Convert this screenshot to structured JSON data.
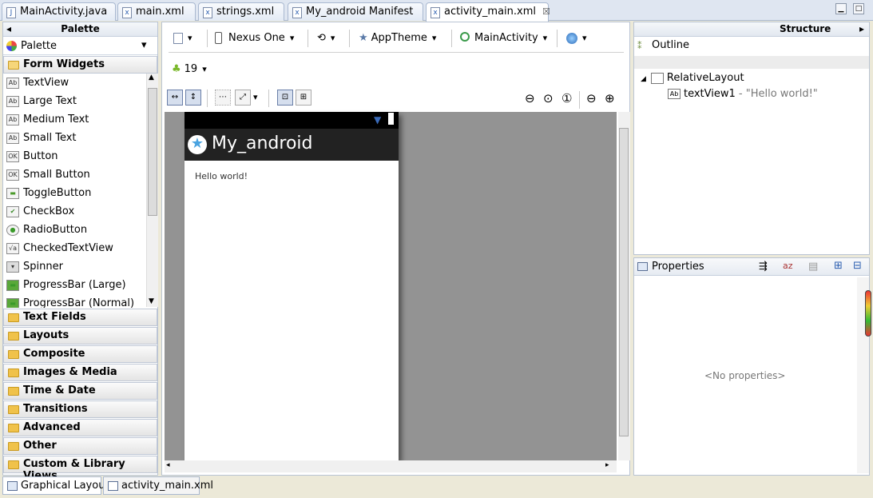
{
  "editor_tabs": [
    {
      "label": "MainActivity.java",
      "icon": "java-file-icon"
    },
    {
      "label": "main.xml",
      "icon": "xml-file-icon"
    },
    {
      "label": "strings.xml",
      "icon": "xml-file-icon"
    },
    {
      "label": "My_android Manifest",
      "icon": "manifest-file-icon"
    },
    {
      "label": "activity_main.xml",
      "icon": "xml-file-icon",
      "close": "☒"
    }
  ],
  "palette": {
    "title": "Palette",
    "selector": "Palette",
    "open_category": "Form Widgets",
    "widgets": [
      {
        "label": "TextView",
        "icon": "Ab"
      },
      {
        "label": "Large Text",
        "icon": "Ab"
      },
      {
        "label": "Medium Text",
        "icon": "Ab"
      },
      {
        "label": "Small Text",
        "icon": "Ab"
      },
      {
        "label": "Button",
        "icon": "OK"
      },
      {
        "label": "Small Button",
        "icon": "OK"
      },
      {
        "label": "ToggleButton",
        "icon": "▬"
      },
      {
        "label": "CheckBox",
        "icon": "✔"
      },
      {
        "label": "RadioButton",
        "icon": "●"
      },
      {
        "label": "CheckedTextView",
        "icon": "√a"
      },
      {
        "label": "Spinner",
        "icon": "▾"
      },
      {
        "label": "ProgressBar (Large)",
        "icon": "▬"
      },
      {
        "label": "ProgressBar (Normal)",
        "icon": "▬"
      }
    ],
    "categories": [
      "Text Fields",
      "Layouts",
      "Composite",
      "Images & Media",
      "Time & Date",
      "Transitions",
      "Advanced",
      "Other",
      "Custom & Library Views"
    ]
  },
  "toolbar": {
    "device": "Nexus One",
    "theme": "AppTheme",
    "activity": "MainActivity",
    "api_level": "19"
  },
  "preview": {
    "app_title": "My_android",
    "text": "Hello world!"
  },
  "structure": {
    "title": "Structure",
    "outline_label": "Outline",
    "root": "RelativeLayout",
    "child_id": "textView1",
    "child_text": " - \"Hello world!\""
  },
  "properties": {
    "title": "Properties",
    "empty": "<No properties>"
  },
  "bottom_tabs": [
    "Graphical Layout",
    "activity_main.xml"
  ]
}
